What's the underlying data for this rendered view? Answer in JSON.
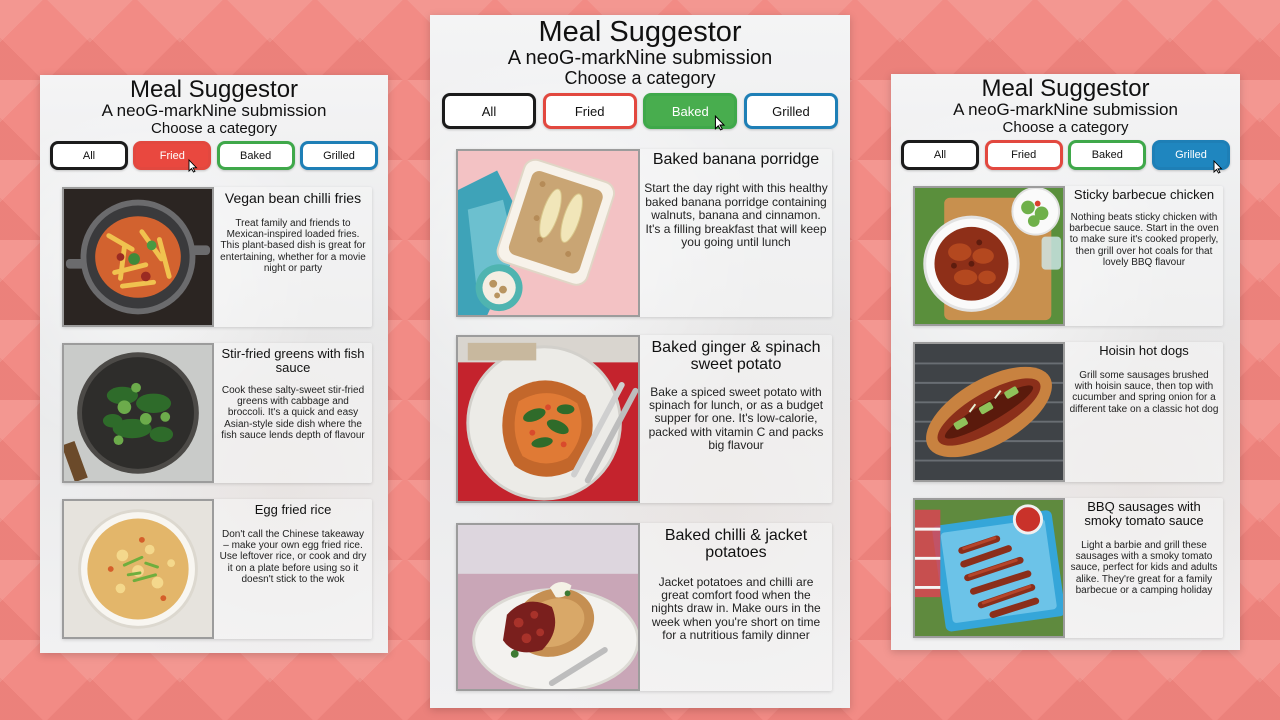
{
  "panels": [
    {
      "title": "Meal Suggestor",
      "subtitle": "A neoG-markNine submission",
      "prompt": "Choose a category",
      "active": "Fried",
      "categories": [
        "All",
        "Fried",
        "Baked",
        "Grilled"
      ],
      "meals": [
        {
          "name": "Vegan bean chilli fries",
          "description": "Treat family and friends to Mexican-inspired loaded fries. This plant-based dish is great for entertaining, whether for a movie night or party",
          "image": "chilli-fries-photo"
        },
        {
          "name": "Stir-fried greens with fish sauce",
          "description": "Cook these salty-sweet stir-fried greens with cabbage and broccoli. It's a quick and easy Asian-style side dish where the fish sauce lends depth of flavour",
          "image": "stir-fried-greens-photo"
        },
        {
          "name": "Egg fried rice",
          "description": "Don't call the Chinese takeaway – make your own egg fried rice. Use leftover rice, or cook and dry it on a plate before using so it doesn't stick to the wok",
          "image": "egg-fried-rice-photo"
        }
      ]
    },
    {
      "title": "Meal Suggestor",
      "subtitle": "A neoG-markNine submission",
      "prompt": "Choose a category",
      "active": "Baked",
      "categories": [
        "All",
        "Fried",
        "Baked",
        "Grilled"
      ],
      "meals": [
        {
          "name": "Baked banana porridge",
          "description": "Start the day right with this healthy baked banana porridge containing walnuts, banana and cinnamon. It's a filling breakfast that will keep you going until lunch",
          "image": "banana-porridge-photo"
        },
        {
          "name": "Baked ginger & spinach sweet potato",
          "description": "Bake a spiced sweet potato with spinach for lunch, or as a budget supper for one. It's low-calorie, packed with vitamin C and packs big flavour",
          "image": "sweet-potato-photo"
        },
        {
          "name": "Baked chilli & jacket potatoes",
          "description": "Jacket potatoes and chilli are great comfort food when the nights draw in. Make ours in the week when you're short on time for a nutritious family dinner",
          "image": "jacket-potato-photo"
        }
      ]
    },
    {
      "title": "Meal Suggestor",
      "subtitle": "A neoG-markNine submission",
      "prompt": "Choose a category",
      "active": "Grilled",
      "categories": [
        "All",
        "Fried",
        "Baked",
        "Grilled"
      ],
      "meals": [
        {
          "name": "Sticky barbecue chicken",
          "description": "Nothing beats sticky chicken with barbecue sauce. Start in the oven to make sure it's cooked properly, then grill over hot coals for that lovely BBQ flavour",
          "image": "bbq-chicken-photo"
        },
        {
          "name": "Hoisin hot dogs",
          "description": "Grill some sausages brushed with hoisin sauce, then top with cucumber and spring onion for a different take on a classic hot dog",
          "image": "hoisin-hotdog-photo"
        },
        {
          "name": "BBQ sausages with smoky tomato sauce",
          "description": "Light a barbie and grill these sausages with a smoky tomato sauce, perfect for kids and adults alike. They're great for a family barbecue or a camping holiday",
          "image": "bbq-sausages-photo"
        }
      ]
    }
  ],
  "colors": {
    "background": "#f28b85",
    "all_border": "#1b1b1b",
    "fried": "#e9483f",
    "baked": "#48ad4e",
    "grilled": "#1f86bf"
  }
}
